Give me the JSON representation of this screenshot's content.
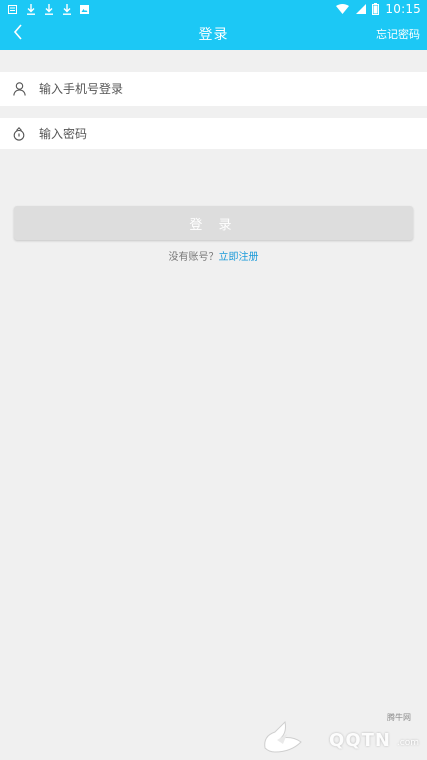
{
  "status_bar": {
    "time": "10:15",
    "icons_left": [
      "notification-icon",
      "download-icon",
      "download-icon",
      "download-icon",
      "image-icon"
    ],
    "icons_right": [
      "wifi-icon",
      "signal-icon",
      "battery-icon"
    ]
  },
  "app_bar": {
    "back_icon": "chevron-left-icon",
    "title": "登录",
    "forgot_password": "忘记密码"
  },
  "form": {
    "phone": {
      "icon": "user-icon",
      "placeholder": "输入手机号登录",
      "value": ""
    },
    "password": {
      "icon": "lock-icon",
      "placeholder": "输入密码",
      "value": ""
    },
    "login_button": "登 录"
  },
  "register": {
    "prompt": "没有账号？",
    "link": "立即注册"
  },
  "watermark": {
    "top": "腾牛网",
    "brand": "QQTN",
    "suffix": ".com"
  },
  "colors": {
    "accent": "#1cc8f5",
    "background": "#f0f0f0",
    "button_disabled": "#dddddd",
    "link": "#1a9ad9"
  }
}
